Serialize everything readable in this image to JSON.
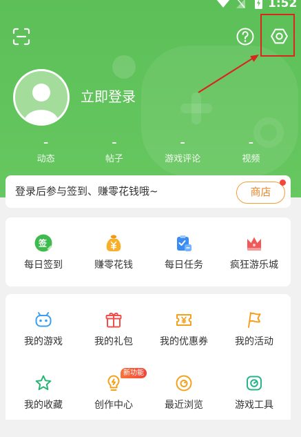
{
  "status_bar": {
    "time": "1:52",
    "icons": [
      "wifi-icon",
      "signal-icon",
      "battery-charging-icon"
    ]
  },
  "toolbar": {
    "left_icon": "scan-icon",
    "right_icons": [
      "help-icon",
      "settings-icon"
    ]
  },
  "profile": {
    "avatar_icon": "default-avatar-icon",
    "login_label": "立即登录"
  },
  "stats": [
    {
      "value": "–",
      "label": "动态"
    },
    {
      "value": "–",
      "label": "帖子"
    },
    {
      "value": "–",
      "label": "游戏评论"
    },
    {
      "value": "–",
      "label": "视频"
    }
  ],
  "promo": {
    "text": "登录后参与签到、赚零花钱哦~",
    "shop_label": "商店",
    "shop_has_dot": true
  },
  "quick_actions": [
    {
      "label": "每日签到",
      "icon": "sign-in-icon",
      "icon_text": "签"
    },
    {
      "label": "赚零花钱",
      "icon": "money-bag-icon"
    },
    {
      "label": "每日任务",
      "icon": "task-clipboard-icon"
    },
    {
      "label": "疯狂游乐城",
      "icon": "crown-icon"
    }
  ],
  "my_items": [
    {
      "label": "我的游戏",
      "icon": "gamepad-icon"
    },
    {
      "label": "我的礼包",
      "icon": "gift-icon"
    },
    {
      "label": "我的优惠券",
      "icon": "coupon-icon"
    },
    {
      "label": "我的活动",
      "icon": "flag-icon"
    },
    {
      "label": "我的收藏",
      "icon": "star-icon"
    },
    {
      "label": "创作中心",
      "icon": "lightbulb-icon",
      "badge": "新功能"
    },
    {
      "label": "最近浏览",
      "icon": "recent-view-icon"
    },
    {
      "label": "游戏工具",
      "icon": "game-tools-icon"
    }
  ],
  "colors": {
    "header_green": "#5fc25a",
    "annotation_red": "#d8261c",
    "shop_orange": "#f0912e",
    "page_bg": "#f1f1f1"
  }
}
